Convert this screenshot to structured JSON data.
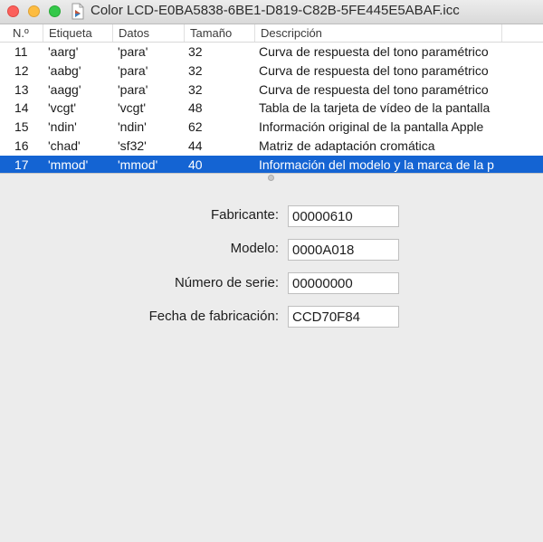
{
  "window": {
    "title": "Color LCD-E0BA5838-6BE1-D819-C82B-5FE445E5ABAF.icc"
  },
  "table": {
    "columns": [
      "N.º",
      "Etiqueta",
      "Datos",
      "Tamaño",
      "Descripción"
    ],
    "rows": [
      {
        "num": "11",
        "tag": "'aarg'",
        "data": "'para'",
        "size": "32",
        "desc": "Curva de respuesta del tono paramétrico"
      },
      {
        "num": "12",
        "tag": "'aabg'",
        "data": "'para'",
        "size": "32",
        "desc": "Curva de respuesta del tono paramétrico"
      },
      {
        "num": "13",
        "tag": "'aagg'",
        "data": "'para'",
        "size": "32",
        "desc": "Curva de respuesta del tono paramétrico"
      },
      {
        "num": "14",
        "tag": "'vcgt'",
        "data": "'vcgt'",
        "size": "48",
        "desc": "Tabla de la tarjeta de vídeo de la pantalla"
      },
      {
        "num": "15",
        "tag": "'ndin'",
        "data": "'ndin'",
        "size": "62",
        "desc": "Información original de la pantalla Apple"
      },
      {
        "num": "16",
        "tag": "'chad'",
        "data": "'sf32'",
        "size": "44",
        "desc": "Matriz de adaptación cromática"
      },
      {
        "num": "17",
        "tag": "'mmod'",
        "data": "'mmod'",
        "size": "40",
        "desc": "Información del modelo y la marca de la p"
      }
    ],
    "selected_index": 6,
    "selection_color": "#1464d3"
  },
  "details": {
    "fabricante_label": "Fabricante:",
    "fabricante_value": "00000610",
    "modelo_label": "Modelo:",
    "modelo_value": "0000A018",
    "serie_label": "Número de serie:",
    "serie_value": "00000000",
    "fecha_label": "Fecha de fabricación:",
    "fecha_value": "CCD70F84"
  }
}
